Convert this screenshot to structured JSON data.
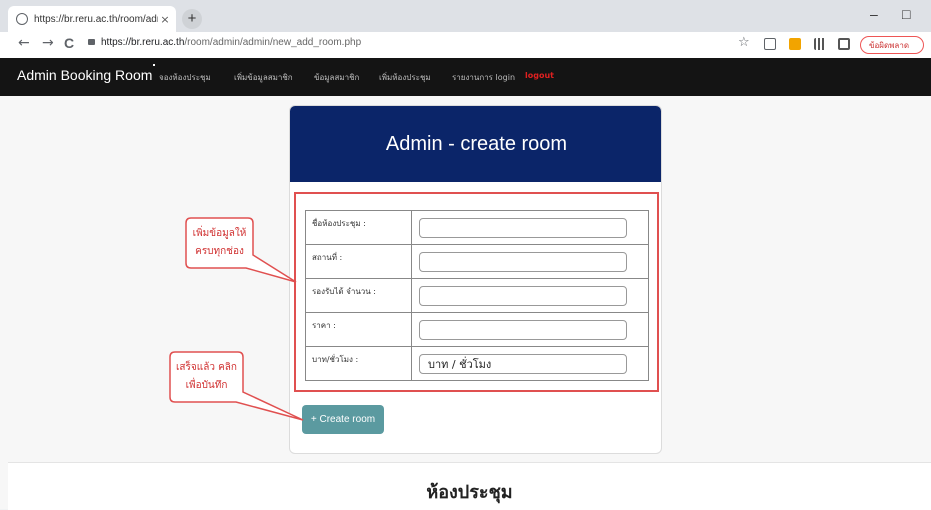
{
  "browser": {
    "tab_title": "https://br.reru.ac.th/room/admin",
    "tab_close": "×",
    "new_tab": "+",
    "minimize": "–",
    "restore": "□",
    "back": "←",
    "forward": "→",
    "reload": "C",
    "url_host": "https://br.reru.ac.th",
    "url_path": "/room/admin/admin/new_add_room.php",
    "bookmark": "☆",
    "profile_label": "ข้อผิดพลาด"
  },
  "navbar": {
    "brand": "Admin Booking Room",
    "items": [
      {
        "label": "จองห้องประชุม"
      },
      {
        "label": "เพิ่มข้อมูลสมาชิก"
      },
      {
        "label": "ข้อมูลสมาชิก"
      },
      {
        "label": "เพิ่มห้องประชุม"
      },
      {
        "label": "รายงานการ login"
      },
      {
        "label": "logout"
      }
    ]
  },
  "form": {
    "title": "Admin - create room",
    "fields": [
      {
        "label": "ชื่อห้องประชุม :",
        "value": ""
      },
      {
        "label": "สถานที่ :",
        "value": ""
      },
      {
        "label": "รองรับได้ จำนวน :",
        "value": ""
      },
      {
        "label": "ราคา :",
        "value": ""
      },
      {
        "label": "บาท/ชั่วโมง :",
        "value": "บาท / ชั่วโมง"
      }
    ],
    "submit_label": "+ Create room"
  },
  "annotations": {
    "fill_line1": "เพิ่มข้อมูลให้",
    "fill_line2": "ครบทุกช่อง",
    "save_line1": "เสร็จแล้ว คลิก",
    "save_line2": "เพื่อบันทึก"
  },
  "section": {
    "title": "ห้องประชุม"
  },
  "colors": {
    "header_blue": "#0b2569",
    "button_teal": "#5b9aa0",
    "annotation_red": "#e05050",
    "logout_red": "#e02020"
  }
}
